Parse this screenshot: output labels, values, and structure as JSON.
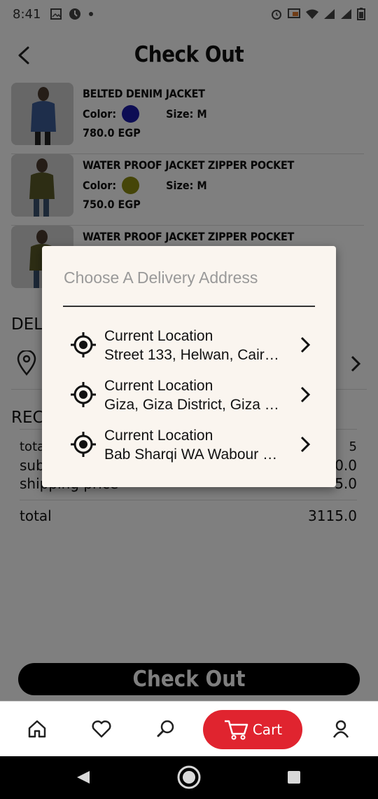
{
  "status": {
    "time": "8:41"
  },
  "header": {
    "title": "Check Out"
  },
  "items": [
    {
      "name": "BELTED DENIM JACKET",
      "color_label": "Color:",
      "color": "#1a1aa8",
      "size_label": "Size: M",
      "price": "780.0 EGP"
    },
    {
      "name": "WATER PROOF JACKET ZIPPER POCKET",
      "color_label": "Color:",
      "color": "#8a8a10",
      "size_label": "Size: M",
      "price": "750.0 EGP"
    },
    {
      "name": "WATER PROOF JACKET ZIPPER POCKET"
    }
  ],
  "delivery": {
    "section_label": "DEL"
  },
  "receipt": {
    "section_label": "REC",
    "rows": [
      {
        "label": "tota",
        "value": "5"
      },
      {
        "label": "sub",
        "value": "0.0"
      },
      {
        "label": "shipping price",
        "value": "5.0"
      }
    ],
    "total_label": "total",
    "total_value": "3115.0"
  },
  "checkout_button": "Check Out",
  "bottom_nav": {
    "cart_label": "Cart"
  },
  "dialog": {
    "title": "Choose A Delivery Address",
    "addresses": [
      {
        "title": "Current Location",
        "address": "Street 133, Helwan, Cairo Governorate"
      },
      {
        "title": "Current Location",
        "address": "Giza, Giza District, Giza Governorate"
      },
      {
        "title": "Current Location",
        "address": "Bab Sharqi WA Wabour El Meyah"
      }
    ]
  },
  "colors": {
    "accent": "#e0242f",
    "dialog_bg": "#faf5ef"
  }
}
